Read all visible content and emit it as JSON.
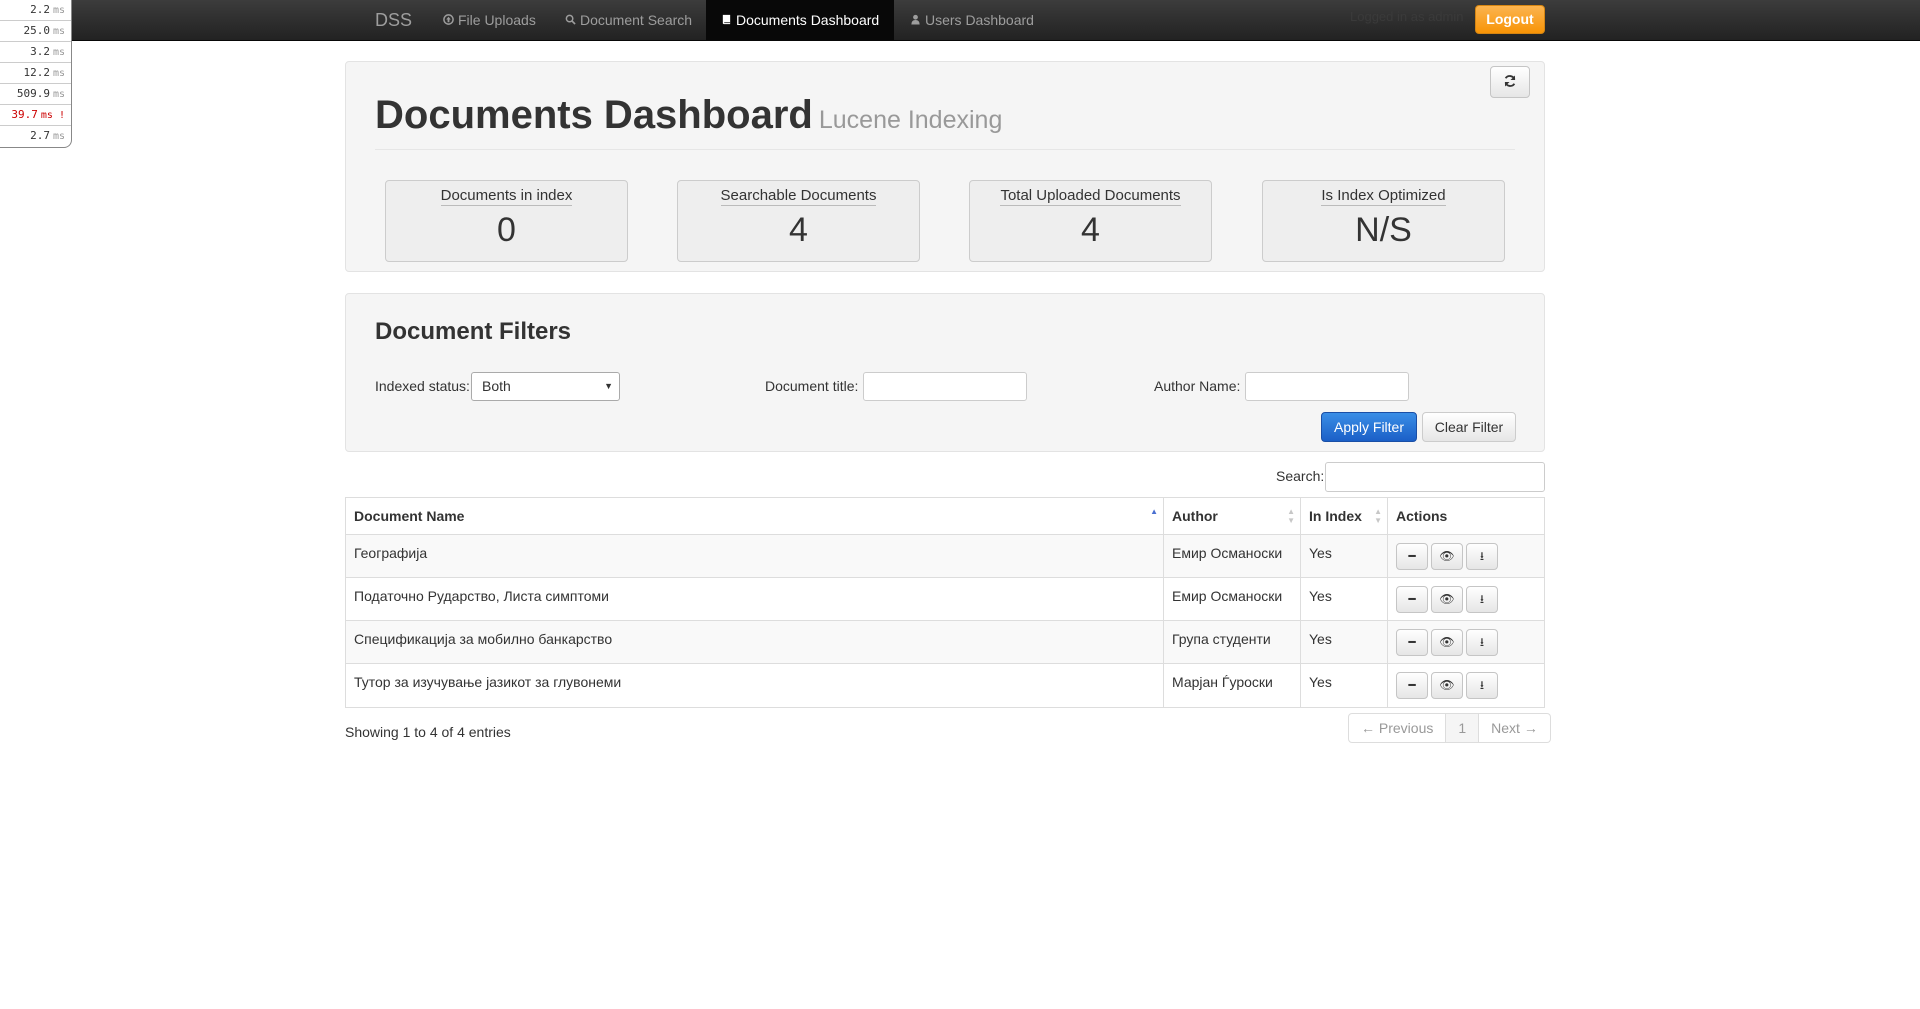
{
  "navbar": {
    "brand": "DSS",
    "items": [
      {
        "label": "File Uploads",
        "icon": "upload-circle-icon"
      },
      {
        "label": "Document Search",
        "icon": "search-icon"
      },
      {
        "label": "Documents Dashboard",
        "icon": "book-icon",
        "active": true
      },
      {
        "label": "Users Dashboard",
        "icon": "user-icon"
      }
    ],
    "logged_in_text": "Logged in as admin",
    "logout_label": "Logout"
  },
  "profiler": [
    {
      "value": "2.2",
      "unit": "ms"
    },
    {
      "value": "25.0",
      "unit": "ms"
    },
    {
      "value": "3.2",
      "unit": "ms"
    },
    {
      "value": "12.2",
      "unit": "ms"
    },
    {
      "value": "509.9",
      "unit": "ms"
    },
    {
      "value": "39.7",
      "unit": "ms !",
      "warning": true
    },
    {
      "value": "2.7",
      "unit": "ms"
    }
  ],
  "header": {
    "title": "Documents Dashboard",
    "subtitle": "Lucene Indexing"
  },
  "stats": [
    {
      "label": "Documents in index",
      "value": "0"
    },
    {
      "label": "Searchable Documents",
      "value": "4"
    },
    {
      "label": "Total Uploaded Documents",
      "value": "4"
    },
    {
      "label": "Is Index Optimized",
      "value": "N/S"
    }
  ],
  "filters": {
    "title": "Document Filters",
    "indexed_status_label": "Indexed status:",
    "indexed_status_value": "Both",
    "document_title_label": "Document title:",
    "document_title_value": "",
    "author_name_label": "Author Name:",
    "author_name_value": "",
    "apply_label": "Apply Filter",
    "clear_label": "Clear Filter"
  },
  "search": {
    "label": "Search:",
    "value": ""
  },
  "table": {
    "columns": [
      "Document Name",
      "Author",
      "In Index",
      "Actions"
    ],
    "rows": [
      {
        "name": "Географија",
        "author": "Емир Османоски",
        "in_index": "Yes"
      },
      {
        "name": "Податочно Рударство, Листа симптоми",
        "author": "Емир Османоски",
        "in_index": "Yes"
      },
      {
        "name": "Спецификација за мобилно банкарство",
        "author": "Група студенти",
        "in_index": "Yes"
      },
      {
        "name": "Тутор за изучување јазикот за глувонеми",
        "author": "Марјан Ѓуроски",
        "in_index": "Yes"
      }
    ]
  },
  "footer": {
    "info": "Showing 1 to 4 of 4 entries",
    "prev_label": "← Previous",
    "page": "1",
    "next_label": "Next →"
  },
  "colors": {
    "accent_blue": "#1b5fc7",
    "logout_orange": "#f89406",
    "navbar_dark": "#222222",
    "warning_red": "#cc0000"
  }
}
